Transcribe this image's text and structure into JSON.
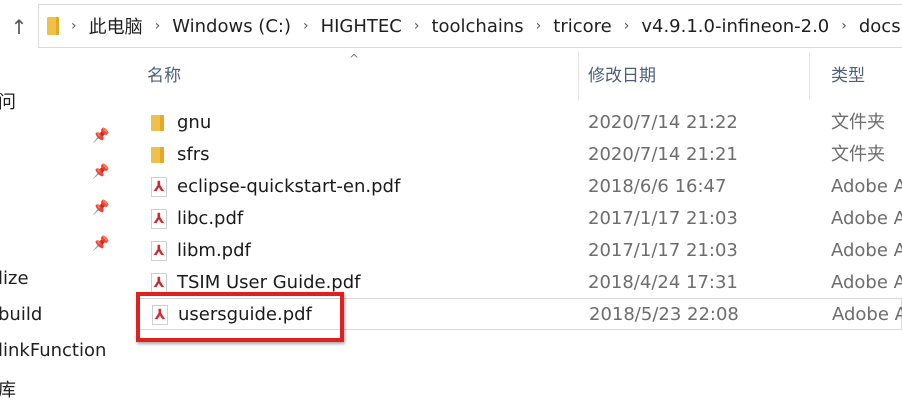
{
  "address": {
    "crumbs": [
      "此电脑",
      "Windows (C:)",
      "HIGHTEC",
      "toolchains",
      "tricore",
      "v4.9.1.0-infineon-2.0",
      "docs"
    ],
    "separator": "›"
  },
  "nav": {
    "items": [
      "问",
      "lize",
      "build",
      "linkFunction",
      "库"
    ]
  },
  "columns": {
    "name": "名称",
    "date": "修改日期",
    "type": "类型"
  },
  "files": [
    {
      "name": "gnu",
      "date": "2020/7/14 21:22",
      "type": "文件夹",
      "icon": "folder-icon"
    },
    {
      "name": "sfrs",
      "date": "2020/7/14 21:21",
      "type": "文件夹",
      "icon": "folder-icon"
    },
    {
      "name": "eclipse-quickstart-en.pdf",
      "date": "2018/6/6 16:47",
      "type": "Adobe A",
      "icon": "pdf-icon"
    },
    {
      "name": "libc.pdf",
      "date": "2017/1/17 21:03",
      "type": "Adobe A",
      "icon": "pdf-icon"
    },
    {
      "name": "libm.pdf",
      "date": "2017/1/17 21:03",
      "type": "Adobe A",
      "icon": "pdf-icon"
    },
    {
      "name": "TSIM User Guide.pdf",
      "date": "2018/4/24 17:31",
      "type": "Adobe A",
      "icon": "pdf-icon"
    },
    {
      "name": "usersguide.pdf",
      "date": "2018/5/23 22:08",
      "type": "Adobe A",
      "icon": "pdf-icon",
      "selected": true
    }
  ],
  "colors": {
    "highlight": "#e02020",
    "folder": "#f1c04b",
    "pdf": "#d7282f"
  }
}
